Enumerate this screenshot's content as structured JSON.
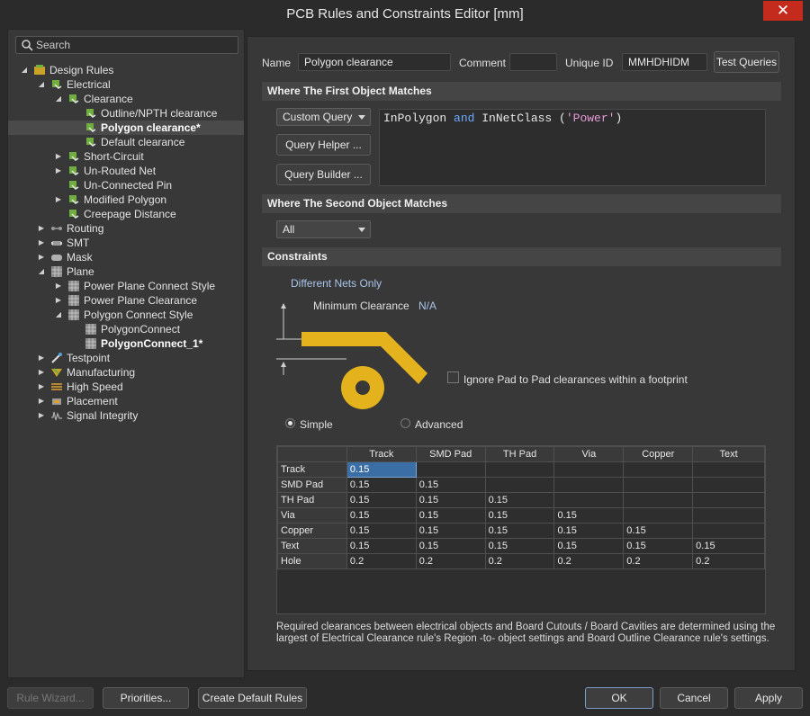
{
  "window": {
    "title": "PCB Rules and Constraints Editor [mm]",
    "close_glyph": "✕"
  },
  "search": {
    "placeholder": "Search"
  },
  "tree": [
    {
      "label": "Design Rules",
      "bold": false,
      "arrow": "◢",
      "icon": "design-rules-icon",
      "name": "tree-item-design-rules"
    },
    {
      "label": "Electrical",
      "bold": false,
      "arrow": "◢",
      "icon": "electrical-rule-icon",
      "name": "tree-item-electrical"
    },
    {
      "label": "Clearance",
      "bold": false,
      "arrow": "◢",
      "icon": "electrical-rule-icon",
      "name": "tree-item-clearance"
    },
    {
      "label": "Outline/NPTH clearance",
      "bold": false,
      "arrow": "",
      "icon": "electrical-rule-icon",
      "name": "tree-item-outline-npth-clearance"
    },
    {
      "label": "Polygon clearance*",
      "bold": true,
      "arrow": "",
      "icon": "electrical-rule-icon",
      "name": "tree-item-polygon-clearance",
      "selected": true
    },
    {
      "label": "Default clearance",
      "bold": false,
      "arrow": "",
      "icon": "electrical-rule-icon",
      "name": "tree-item-default-clearance"
    },
    {
      "label": "Short-Circuit",
      "bold": false,
      "arrow": "▶",
      "icon": "electrical-rule-icon",
      "name": "tree-item-short-circuit"
    },
    {
      "label": "Un-Routed Net",
      "bold": false,
      "arrow": "▶",
      "icon": "electrical-rule-icon",
      "name": "tree-item-un-routed-net"
    },
    {
      "label": "Un-Connected Pin",
      "bold": false,
      "arrow": "",
      "icon": "electrical-rule-icon",
      "name": "tree-item-un-connected-pin"
    },
    {
      "label": "Modified Polygon",
      "bold": false,
      "arrow": "▶",
      "icon": "electrical-rule-icon",
      "name": "tree-item-modified-polygon"
    },
    {
      "label": "Creepage Distance",
      "bold": false,
      "arrow": "",
      "icon": "electrical-rule-icon",
      "name": "tree-item-creepage-distance"
    },
    {
      "label": "Routing",
      "bold": false,
      "arrow": "▶",
      "icon": "routing-icon",
      "name": "tree-item-routing"
    },
    {
      "label": "SMT",
      "bold": false,
      "arrow": "▶",
      "icon": "smt-icon",
      "name": "tree-item-smt"
    },
    {
      "label": "Mask",
      "bold": false,
      "arrow": "▶",
      "icon": "mask-icon",
      "name": "tree-item-mask"
    },
    {
      "label": "Plane",
      "bold": false,
      "arrow": "◢",
      "icon": "plane-icon",
      "name": "tree-item-plane"
    },
    {
      "label": "Power Plane Connect Style",
      "bold": false,
      "arrow": "▶",
      "icon": "plane-icon",
      "name": "tree-item-power-plane-connect-style"
    },
    {
      "label": "Power Plane Clearance",
      "bold": false,
      "arrow": "▶",
      "icon": "plane-icon",
      "name": "tree-item-power-plane-clearance"
    },
    {
      "label": "Polygon Connect Style",
      "bold": false,
      "arrow": "◢",
      "icon": "plane-icon",
      "name": "tree-item-polygon-connect-style"
    },
    {
      "label": "PolygonConnect",
      "bold": false,
      "arrow": "",
      "icon": "plane-icon",
      "name": "tree-item-polygonconnect"
    },
    {
      "label": "PolygonConnect_1*",
      "bold": true,
      "arrow": "",
      "icon": "plane-icon",
      "name": "tree-item-polygonconnect-1"
    },
    {
      "label": "Testpoint",
      "bold": false,
      "arrow": "▶",
      "icon": "testpoint-icon",
      "name": "tree-item-testpoint"
    },
    {
      "label": "Manufacturing",
      "bold": false,
      "arrow": "▶",
      "icon": "manufacturing-icon",
      "name": "tree-item-manufacturing"
    },
    {
      "label": "High Speed",
      "bold": false,
      "arrow": "▶",
      "icon": "high-speed-icon",
      "name": "tree-item-high-speed"
    },
    {
      "label": "Placement",
      "bold": false,
      "arrow": "▶",
      "icon": "placement-icon",
      "name": "tree-item-placement"
    },
    {
      "label": "Signal Integrity",
      "bold": false,
      "arrow": "▶",
      "icon": "signal-integrity-icon",
      "name": "tree-item-signal-integrity"
    }
  ],
  "rule": {
    "name_label": "Name",
    "name_value": "Polygon clearance",
    "comment_label": "Comment",
    "comment_value": "",
    "uid_label": "Unique ID",
    "uid_value": "MMHDHIDM",
    "test_queries": "Test Queries"
  },
  "first_match": {
    "heading": "Where The First Object Matches",
    "mode": "Custom Query",
    "query_helper": "Query Helper ...",
    "query_builder": "Query Builder ...",
    "query": {
      "p1": "InPolygon ",
      "kw": "and",
      "p2": " InNetClass (",
      "str": "'Power'",
      "p3": ")"
    }
  },
  "second_match": {
    "heading": "Where The Second Object Matches",
    "mode": "All"
  },
  "constraints": {
    "heading": "Constraints",
    "diff_nets": "Different Nets Only",
    "min_clearance_label": "Minimum Clearance",
    "min_clearance_value": "N/A",
    "ignore_pad_label": "Ignore Pad to Pad clearances within a footprint",
    "ignore_pad_checked": false,
    "mode_simple": "Simple",
    "mode_advanced": "Advanced",
    "selected_mode": "Simple",
    "accent_color": "#e3b21c"
  },
  "grid": {
    "columns": [
      "Track",
      "SMD Pad",
      "TH Pad",
      "Via",
      "Copper",
      "Text"
    ],
    "rows": [
      {
        "label": "Track",
        "values": [
          "0.15"
        ]
      },
      {
        "label": "SMD Pad",
        "values": [
          "0.15",
          "0.15"
        ]
      },
      {
        "label": "TH Pad",
        "values": [
          "0.15",
          "0.15",
          "0.15"
        ]
      },
      {
        "label": "Via",
        "values": [
          "0.15",
          "0.15",
          "0.15",
          "0.15"
        ]
      },
      {
        "label": "Copper",
        "values": [
          "0.15",
          "0.15",
          "0.15",
          "0.15",
          "0.15"
        ]
      },
      {
        "label": "Text",
        "values": [
          "0.15",
          "0.15",
          "0.15",
          "0.15",
          "0.15",
          "0.15"
        ]
      },
      {
        "label": "Hole",
        "values": [
          "0.2",
          "0.2",
          "0.2",
          "0.2",
          "0.2",
          "0.2"
        ]
      }
    ]
  },
  "note": "Required clearances between electrical objects and Board Cutouts / Board Cavities are determined using the largest of Electrical Clearance rule's Region -to- object settings and Board Outline Clearance rule's settings.",
  "footer": {
    "rule_wizard": "Rule Wizard...",
    "priorities": "Priorities...",
    "create_default": "Create Default Rules",
    "ok": "OK",
    "cancel": "Cancel",
    "apply": "Apply"
  }
}
